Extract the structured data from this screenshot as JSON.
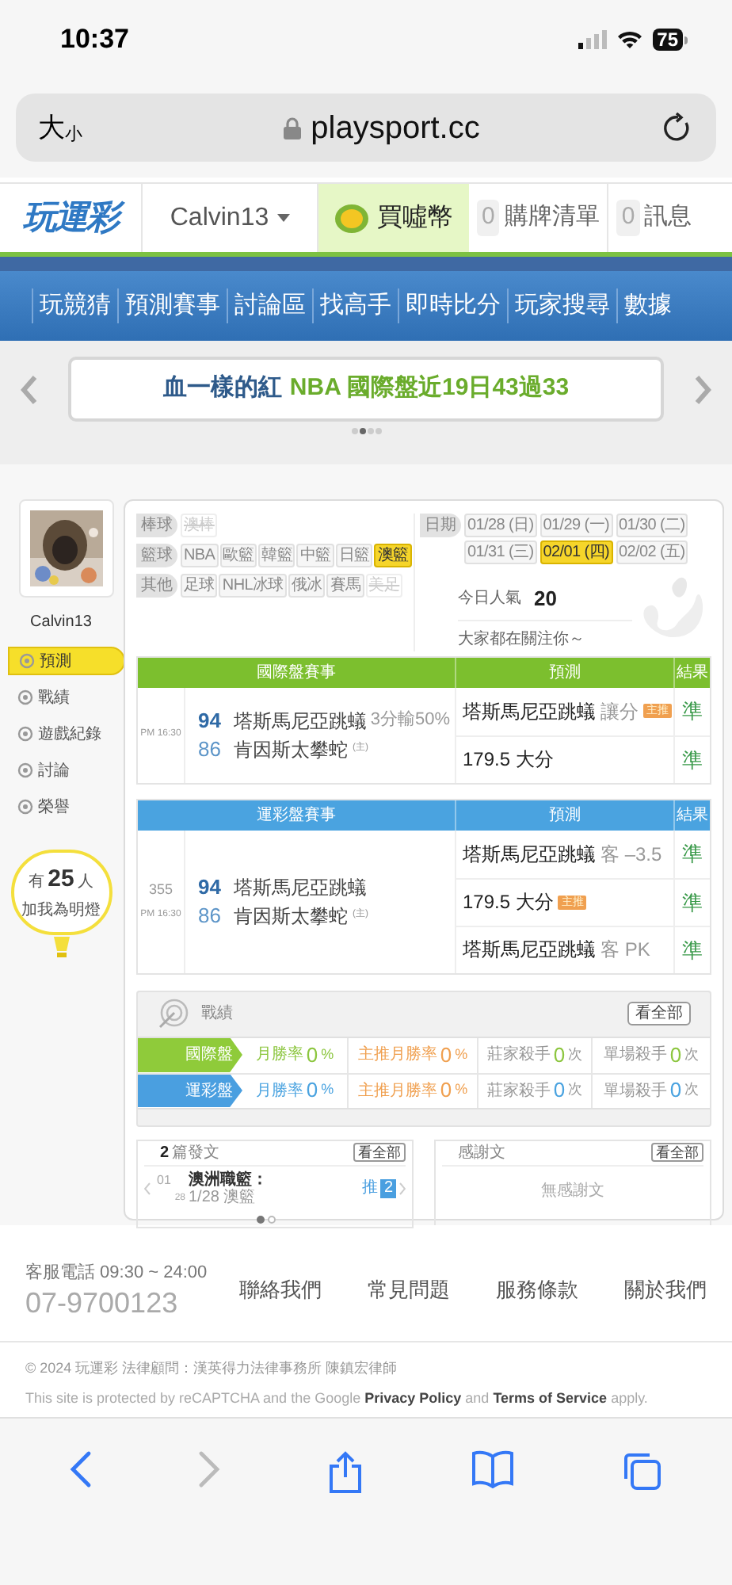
{
  "status_bar": {
    "time": "10:37",
    "battery": "75"
  },
  "browser": {
    "text_size_large": "大",
    "text_size_small": "小",
    "url": "playsport.cc"
  },
  "site_header": {
    "logo": "玩運彩",
    "username": "Calvin13",
    "coin_button": "買噓幣",
    "links": [
      {
        "count": "0",
        "label": "購牌清單"
      },
      {
        "count": "0",
        "label": "訊息"
      }
    ]
  },
  "main_nav": [
    "玩競猜",
    "預測賽事",
    "討論區",
    "找高手",
    "即時比分",
    "玩家搜尋",
    "數據"
  ],
  "banner": {
    "author": "血一樣的紅",
    "headline": "NBA 國際盤近19日43過33",
    "slides": [
      {
        "selected": false
      },
      {
        "selected": true
      },
      {
        "selected": false
      },
      {
        "selected": false
      }
    ]
  },
  "profile": {
    "username": "Calvin13",
    "menu": [
      {
        "label": "預測",
        "selected": true
      },
      {
        "label": "戰績",
        "selected": false
      },
      {
        "label": "遊戲紀錄",
        "selected": false
      },
      {
        "label": "討論",
        "selected": false
      },
      {
        "label": "榮譽",
        "selected": false
      }
    ],
    "fans": {
      "prefix": "有",
      "count": "25",
      "suffix": "人",
      "caption": "加我為明燈"
    }
  },
  "sport_filters": [
    {
      "category": "棒球",
      "options": [
        {
          "label": "澳棒",
          "selected": false,
          "disabled": true
        }
      ]
    },
    {
      "category": "籃球",
      "options": [
        {
          "label": "NBA",
          "selected": false,
          "disabled": false
        },
        {
          "label": "歐籃",
          "selected": false,
          "disabled": false
        },
        {
          "label": "韓籃",
          "selected": false,
          "disabled": false
        },
        {
          "label": "中籃",
          "selected": false,
          "disabled": false
        },
        {
          "label": "日籃",
          "selected": false,
          "disabled": false
        },
        {
          "label": "澳籃",
          "selected": true,
          "disabled": false
        }
      ]
    },
    {
      "category": "其他",
      "options": [
        {
          "label": "足球",
          "selected": false,
          "disabled": false
        },
        {
          "label": "NHL冰球",
          "selected": false,
          "disabled": false
        },
        {
          "label": "俄冰",
          "selected": false,
          "disabled": false
        },
        {
          "label": "賽馬",
          "selected": false,
          "disabled": false
        },
        {
          "label": "美足",
          "selected": false,
          "disabled": true
        }
      ]
    }
  ],
  "dates": {
    "label": "日期",
    "options": [
      {
        "label": "01/28 (日)",
        "selected": false
      },
      {
        "label": "01/29 (一)",
        "selected": false
      },
      {
        "label": "01/30 (二)",
        "selected": false
      },
      {
        "label": "01/31 (三)",
        "selected": false
      },
      {
        "label": "02/01 (四)",
        "selected": true
      },
      {
        "label": "02/02 (五)",
        "selected": false
      }
    ]
  },
  "popularity": {
    "label": "今日人氣",
    "value": "20",
    "message": "大家都在關注你～"
  },
  "games": [
    {
      "kind": "international",
      "title": "國際盤賽事",
      "prediction_header": "預測",
      "result_header": "結果",
      "time": "PM 16:30",
      "teams": [
        {
          "score": "94",
          "name": "塔斯馬尼亞跳蟻"
        },
        {
          "score": "86",
          "name": "肯因斯太攀蛇",
          "home_mark": "(主)"
        }
      ],
      "note": "3分輸50%",
      "picks": [
        {
          "main": "塔斯馬尼亞跳蟻",
          "detail": "讓分",
          "badge": "主推",
          "result": "準"
        },
        {
          "main": "179.5 大分",
          "result": "準"
        }
      ]
    },
    {
      "kind": "lottery",
      "title": "運彩盤賽事",
      "prediction_header": "預測",
      "result_header": "結果",
      "number": "355",
      "time": "PM 16:30",
      "teams": [
        {
          "score": "94",
          "name": "塔斯馬尼亞跳蟻"
        },
        {
          "score": "86",
          "name": "肯因斯太攀蛇",
          "home_mark": "(主)"
        }
      ],
      "picks": [
        {
          "main": "塔斯馬尼亞跳蟻",
          "detail": "客 –3.5",
          "result": "準"
        },
        {
          "main": "179.5 大分",
          "badge": "主推",
          "result": "準"
        },
        {
          "main": "塔斯馬尼亞跳蟻",
          "detail": "客 PK",
          "result": "準"
        }
      ]
    }
  ],
  "record": {
    "title": "戰績",
    "view_all": "看全部",
    "rows": [
      {
        "kind": "international",
        "label": "國際盤",
        "stats": [
          {
            "label": "月勝率",
            "value": "0",
            "unit": "%"
          },
          {
            "label": "主推月勝率",
            "value": "0",
            "unit": "%"
          },
          {
            "label": "莊家殺手",
            "value": "0",
            "unit": "次"
          },
          {
            "label": "單場殺手",
            "value": "0",
            "unit": "次"
          }
        ]
      },
      {
        "kind": "lottery",
        "label": "運彩盤",
        "stats": [
          {
            "label": "月勝率",
            "value": "0",
            "unit": "%"
          },
          {
            "label": "主推月勝率",
            "value": "0",
            "unit": "%"
          },
          {
            "label": "莊家殺手",
            "value": "0",
            "unit": "次"
          },
          {
            "label": "單場殺手",
            "value": "0",
            "unit": "次"
          }
        ]
      }
    ]
  },
  "posts": {
    "count": "2",
    "title": "篇發文",
    "view_all": "看全部",
    "items": [
      {
        "month": "01",
        "day": "28",
        "title": "澳洲職籃：",
        "subtitle": "1/28 澳籃",
        "push_label": "推",
        "push_count": "2"
      }
    ],
    "pages": [
      {
        "selected": true
      },
      {
        "selected": false
      }
    ]
  },
  "thanks": {
    "title": "感謝文",
    "view_all": "看全部",
    "empty": "無感謝文"
  },
  "footer": {
    "hotline_label": "客服電話 09:30 ~ 24:00",
    "phone": "07-9700123",
    "links": [
      "聯絡我們",
      "常見問題",
      "服務條款",
      "關於我們"
    ],
    "copyright": "© 2024 玩運彩 法律顧問：漢英得力法律事務所 陳鎮宏律師",
    "recaptcha": "This site is protected by reCAPTCHA and the Google **Privacy Policy** and **Terms of Service** apply."
  }
}
